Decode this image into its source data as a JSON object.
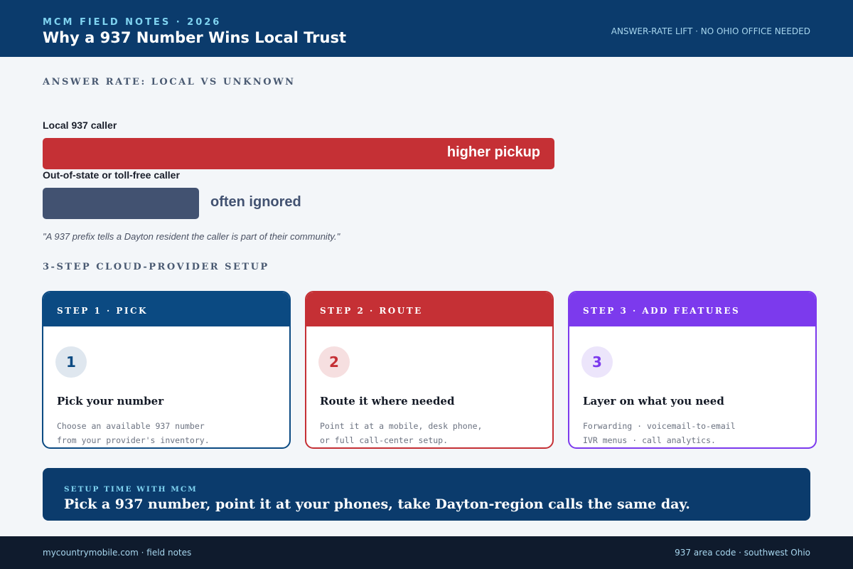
{
  "header": {
    "eyebrow": "MCM FIELD NOTES · 2026",
    "title": "Why a 937 Number Wins Local Trust",
    "right_tag": "ANSWER-RATE LIFT · NO OHIO OFFICE NEEDED"
  },
  "answer_rate": {
    "heading": "ANSWER RATE: LOCAL VS UNKNOWN",
    "local": {
      "label": "Local 937 caller",
      "bar_text": "higher pickup"
    },
    "unknown": {
      "label": "Out-of-state or toll-free caller",
      "bar_text": "often ignored"
    },
    "quote": "\"A 937 prefix tells a Dayton resident the caller is part of their community.\""
  },
  "setup": {
    "heading": "3-STEP CLOUD-PROVIDER SETUP",
    "steps": [
      {
        "header": "STEP 1 · PICK",
        "number": "1",
        "title": "Pick your number",
        "line1": "Choose an available 937 number",
        "line2": "from your provider's inventory."
      },
      {
        "header": "STEP 2 · ROUTE",
        "number": "2",
        "title": "Route it where needed",
        "line1": "Point it at a mobile, desk phone,",
        "line2": "or full call-center setup."
      },
      {
        "header": "STEP 3 · ADD FEATURES",
        "number": "3",
        "title": "Layer on what you need",
        "line1": "Forwarding · voicemail-to-email",
        "line2": "IVR menus · call analytics."
      }
    ]
  },
  "banner": {
    "label": "SETUP TIME WITH MCM",
    "text": "Pick a 937 number, point it at your phones, take Dayton-region calls the same day."
  },
  "footer": {
    "left": "mycountrymobile.com · field notes",
    "right": "937 area code · southwest Ohio"
  },
  "colors": {
    "navy": "#0b3b6c",
    "red": "#c53035",
    "slate": "#425271",
    "purple": "#7c3aed",
    "step1": "#0b4a82"
  }
}
